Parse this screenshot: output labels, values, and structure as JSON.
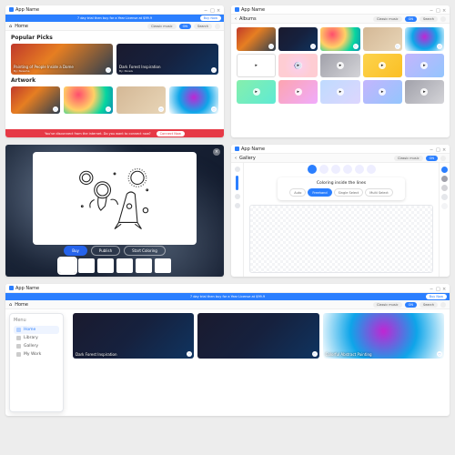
{
  "app_name": "App Name",
  "trial_banner": "7 day trial then buy for a Year License at $99.9",
  "buy_now": "Buy Now",
  "nav_home": "Home",
  "music_mode": "Classic music",
  "music_toggle": "ON",
  "search": "Search",
  "s1": {
    "section1": "Popular Picks",
    "section2": "Artwork",
    "card1_title": "Painting of People Inside a Dome",
    "card1_sub": "By: Newsha",
    "card2_title": "Dark Forest Inspiration",
    "card2_sub": "By: Pexels",
    "offline_msg": "You've disconnect from the internet. Do you want to connect now?",
    "connect": "Connect Now"
  },
  "s2": {
    "title": "Albums"
  },
  "s3": {
    "buy": "Buy",
    "publish": "Publish",
    "start": "Start Coloring"
  },
  "s4": {
    "title": "Gallery",
    "panel_title": "Coloring inside the lines",
    "opt_auto": "Auto",
    "opt_free": "Freehand",
    "opt_single": "Single Select",
    "opt_multi": "Multi Select"
  },
  "s5": {
    "menu_title": "Menu",
    "m_home": "Home",
    "m_library": "Library",
    "m_gallery": "Gallery",
    "m_mywork": "My Work",
    "card1": "Dark Forest Inspiration",
    "card2": "Colorful Abstract Painting"
  }
}
